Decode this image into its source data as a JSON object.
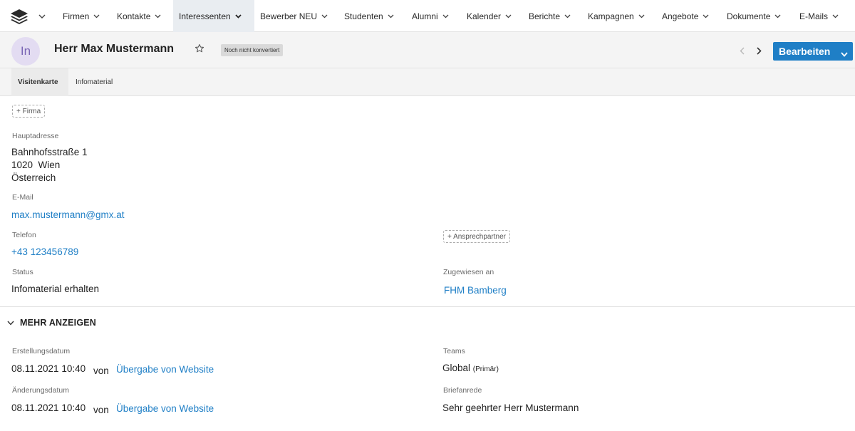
{
  "nav": {
    "logo_icon": "stack-layers-icon",
    "items": [
      {
        "label": "Firmen"
      },
      {
        "label": "Kontakte"
      },
      {
        "label": "Interessenten"
      },
      {
        "label": "Bewerber NEU"
      },
      {
        "label": "Studenten"
      },
      {
        "label": "Alumni"
      },
      {
        "label": "Kalender"
      },
      {
        "label": "Berichte"
      },
      {
        "label": "Kampagnen"
      },
      {
        "label": "Angebote"
      },
      {
        "label": "Dokumente"
      },
      {
        "label": "E-Mails"
      }
    ],
    "active_index": 2
  },
  "record": {
    "avatar_initials": "In",
    "title": "Herr Max Mustermann",
    "status_badge": "Noch nicht konvertiert",
    "edit_label": "Bearbeiten"
  },
  "tabs": [
    {
      "label": "Visitenkarte",
      "active": true
    },
    {
      "label": "Infomaterial",
      "active": false
    }
  ],
  "details": {
    "add_company_label": "+ Firma",
    "address_label": "Hauptadresse",
    "address_line1": "Bahnhofsstraße 1",
    "address_line2": "1020  Wien",
    "address_line3": "Österreich",
    "email_label": "E-Mail",
    "email": "max.mustermann@gmx.at",
    "phone_label": "Telefon",
    "phone": "+43 123456789",
    "add_contact_label": "+ Ansprechpartner",
    "status_label": "Status",
    "status": "Infomaterial erhalten",
    "assigned_label": "Zugewiesen an",
    "assigned": "FHM Bamberg"
  },
  "more": {
    "toggle_label": "MEHR ANZEIGEN",
    "created_label": "Erstellungsdatum",
    "created_date": "08.11.2021 10:40",
    "created_by_prefix": "von",
    "created_by": "Übergabe von Website",
    "modified_label": "Änderungsdatum",
    "modified_date": "08.11.2021 10:40",
    "modified_by_prefix": "von",
    "modified_by": "Übergabe von Website",
    "teams_label": "Teams",
    "teams_value": "Global",
    "teams_suffix": "(Primär)",
    "salutation_label": "Briefanrede",
    "salutation": "Sehr geehrter Herr Mustermann"
  },
  "colors": {
    "accent": "#1f7fc6",
    "avatar_bg": "#e3dcf2",
    "avatar_text": "#7a65b5",
    "header_bg": "#f4f4f4"
  }
}
